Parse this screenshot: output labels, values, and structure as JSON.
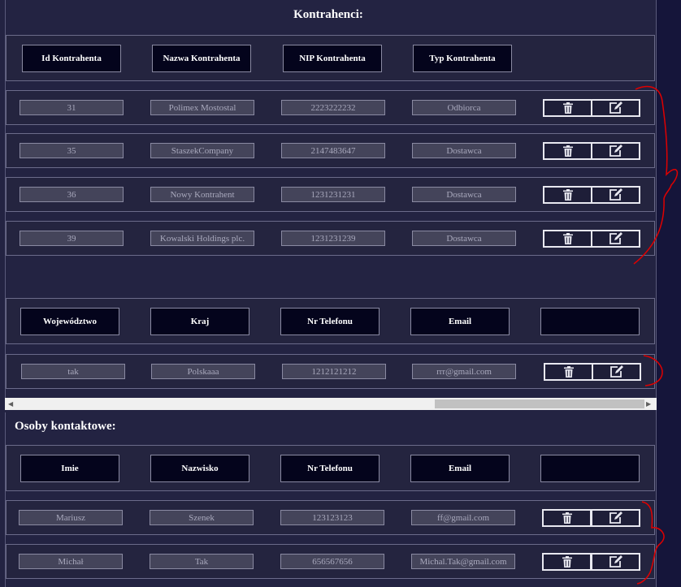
{
  "contractors": {
    "title": "Kontrahenci:",
    "headers": [
      "Id Kontrahenta",
      "Nazwa Kontrahenta",
      "NIP Kontrahenta",
      "Typ Kontrahenta"
    ],
    "rows": [
      [
        "31",
        "Polimex Mostostal",
        "2223222232",
        "Odbiorca"
      ],
      [
        "35",
        "StaszekCompany",
        "2147483647",
        "Dostawca"
      ],
      [
        "36",
        "Nowy Kontrahent",
        "1231231231",
        "Dostawca"
      ],
      [
        "39",
        "Kowalski Holdings plc.",
        "1231231239",
        "Dostawca"
      ]
    ]
  },
  "details": {
    "headers": [
      "Województwo",
      "Kraj",
      "Nr Telefonu",
      "Email",
      ""
    ],
    "rows": [
      [
        "tak",
        "Polskaaa",
        "1212121212",
        "rrr@gmail.com"
      ]
    ]
  },
  "contacts": {
    "title": "Osoby kontaktowe:",
    "headers": [
      "Imie",
      "Nazwisko",
      "Nr Telefonu",
      "Email",
      ""
    ],
    "rows": [
      [
        "Mariusz",
        "Szenek",
        "123123123",
        "ff@gmail.com"
      ],
      [
        "Michał",
        "Tak",
        "656567656",
        "Michal.Tak@gmail.com"
      ]
    ]
  },
  "icons": {
    "delete": "trash-icon",
    "edit": "edit-icon"
  },
  "colors": {
    "background": "#232342",
    "header_cell": "#04041c",
    "data_cell": "#44445a",
    "annotation": "#e00000"
  }
}
